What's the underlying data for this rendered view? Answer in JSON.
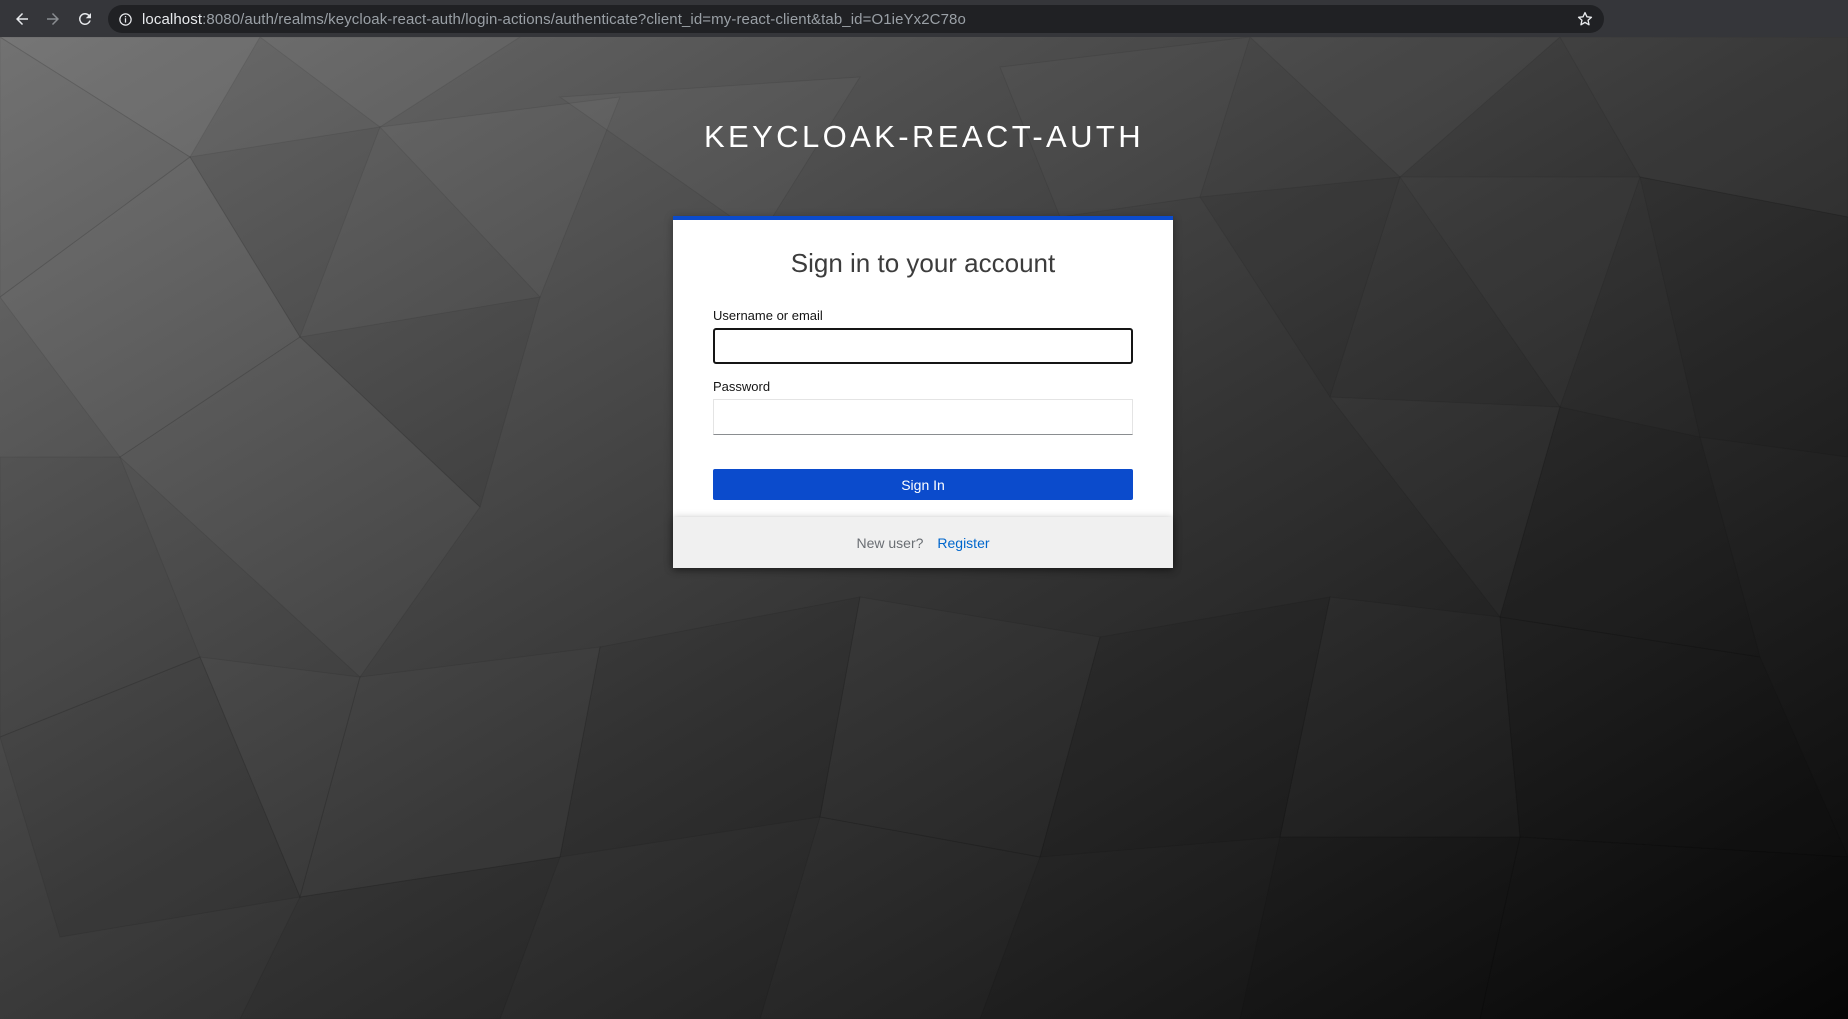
{
  "browser": {
    "url_host": "localhost",
    "url_rest": ":8080/auth/realms/keycloak-react-auth/login-actions/authenticate?client_id=my-react-client&tab_id=O1ieYx2C78o"
  },
  "page": {
    "realm_title": "KEYCLOAK-REACT-AUTH",
    "card_title": "Sign in to your account",
    "username_label": "Username or email",
    "username_value": "",
    "password_label": "Password",
    "password_value": "",
    "signin_label": "Sign In",
    "new_user_text": "New user?",
    "register_link": "Register"
  },
  "colors": {
    "accent": "#0b4bcc",
    "link": "#0066cc",
    "chrome_bg": "#35363a",
    "omnibox_bg": "#202124"
  }
}
